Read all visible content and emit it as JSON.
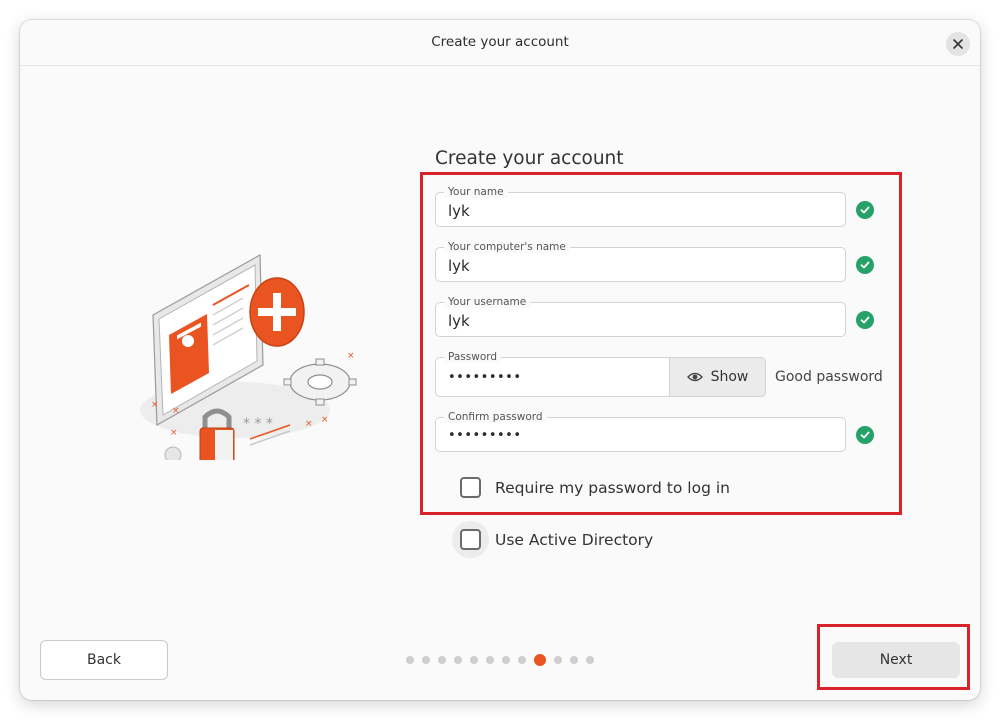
{
  "window": {
    "title": "Create your account"
  },
  "form": {
    "heading": "Create your account",
    "name": {
      "label": "Your name",
      "value": "lyk"
    },
    "computer_name": {
      "label": "Your computer's name",
      "value": "lyk"
    },
    "username": {
      "label": "Your username",
      "value": "lyk"
    },
    "password": {
      "label": "Password",
      "value": "•••••••••",
      "show_label": "Show",
      "strength": "Good password"
    },
    "confirm_password": {
      "label": "Confirm password",
      "value": "•••••••••"
    },
    "require_password_label": "Require my password to log in",
    "active_directory_label": "Use Active Directory"
  },
  "navigation": {
    "back_label": "Back",
    "next_label": "Next",
    "pages_total": 12,
    "current_page": 9
  },
  "colors": {
    "accent": "#e95420",
    "success": "#26a269",
    "highlight": "#d9232a"
  }
}
